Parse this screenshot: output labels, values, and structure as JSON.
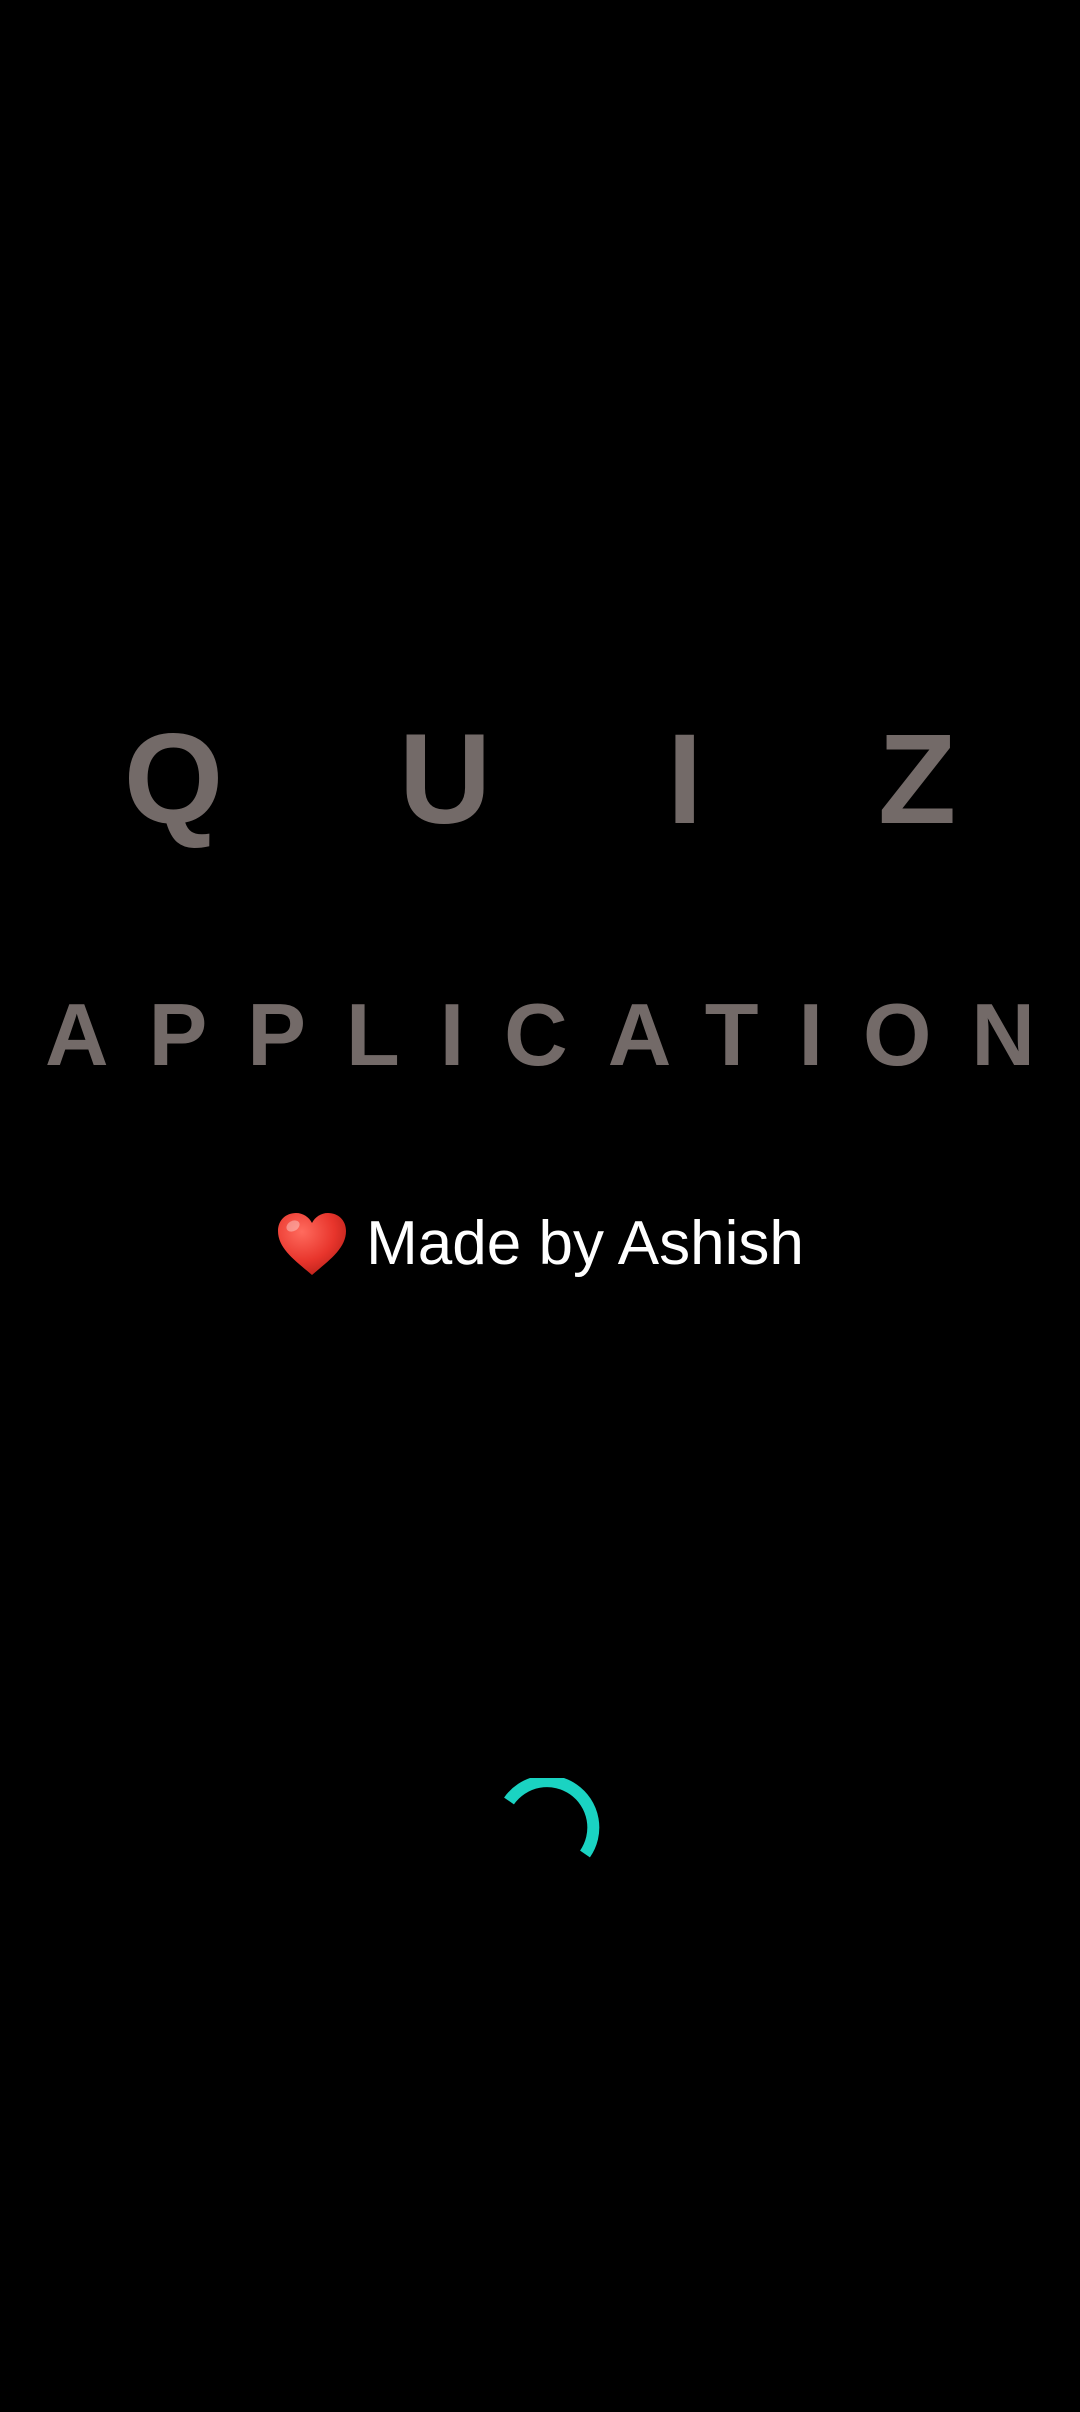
{
  "splash": {
    "title_line1": "Q U I Z",
    "title_line2": "APPLICATION",
    "credit_text": "Made by Ashish",
    "credit_icon": "heart-icon"
  },
  "loading_indicator": {
    "icon": "loading-spinner-icon",
    "accent_color": "#1ad3c2"
  },
  "colors": {
    "background": "#000000",
    "title": "#736a68",
    "credit_text": "#ffffff",
    "heart": "#e8352c"
  }
}
